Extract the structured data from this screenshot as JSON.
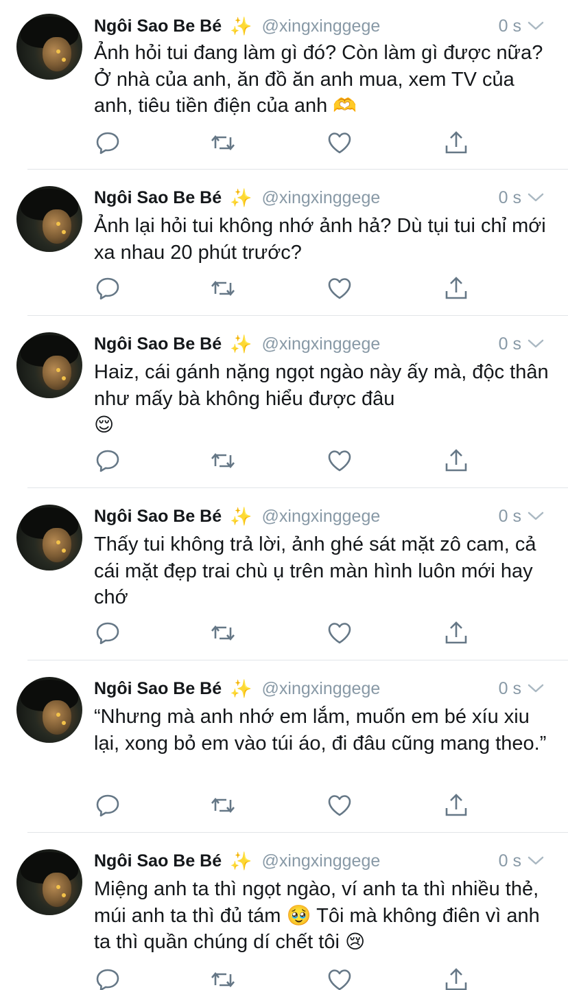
{
  "colors": {
    "text": "#14171a",
    "muted": "#8899a6",
    "divider": "#e1e4e8",
    "icon": "#657786",
    "sparkle": "#f5c542"
  },
  "tweets": [
    {
      "name": "Ngôi Sao Be Bé",
      "sparkle": "✨",
      "handle": "@xingxinggege",
      "time": "0 s",
      "text": " Ảnh hỏi tui đang làm gì đó? Còn làm gì được nữa? Ở nhà của anh, ăn đồ ăn anh mua, xem TV của anh, tiêu tiền điện của anh",
      "emoji": "🫶"
    },
    {
      "name": "Ngôi Sao Be Bé",
      "sparkle": "✨",
      "handle": "@xingxinggege",
      "time": "0 s",
      "text": "Ảnh lại hỏi tui không nhớ ảnh hả? Dù tụi tui chỉ mới xa nhau 20 phút trước?",
      "emoji": ""
    },
    {
      "name": "Ngôi Sao Be Bé",
      "sparkle": "✨",
      "handle": "@xingxinggege",
      "time": "0 s",
      "text": "Haiz, cái gánh nặng ngọt ngào này ấy mà, độc thân như mấy bà không hiểu được đâu",
      "emoji": "😌"
    },
    {
      "name": "Ngôi Sao Be Bé",
      "sparkle": "✨",
      "handle": "@xingxinggege",
      "time": "0 s",
      "text": "Thấy tui không trả lời, ảnh ghé sát mặt zô cam, cả cái mặt đẹp trai chù ụ trên màn hình luôn mới hay chớ",
      "emoji": ""
    },
    {
      "name": "Ngôi Sao Be Bé",
      "sparkle": "✨",
      "handle": "@xingxinggege",
      "time": "0 s",
      "text": "“Nhưng mà anh nhớ em lắm, muốn em bé xíu xiu lại, xong bỏ em vào túi áo, đi đâu cũng mang theo.”",
      "emoji": ""
    },
    {
      "name": "Ngôi Sao Be Bé",
      "sparkle": "✨",
      "handle": "@xingxinggege",
      "time": "0 s",
      "text": "Miệng anh ta thì ngọt ngào, ví anh ta thì nhiều thẻ, múi anh ta thì đủ tám 🥹  Tôi mà không điên vì anh ta thì quần chúng dí chết tôi",
      "emoji": "😢"
    }
  ]
}
